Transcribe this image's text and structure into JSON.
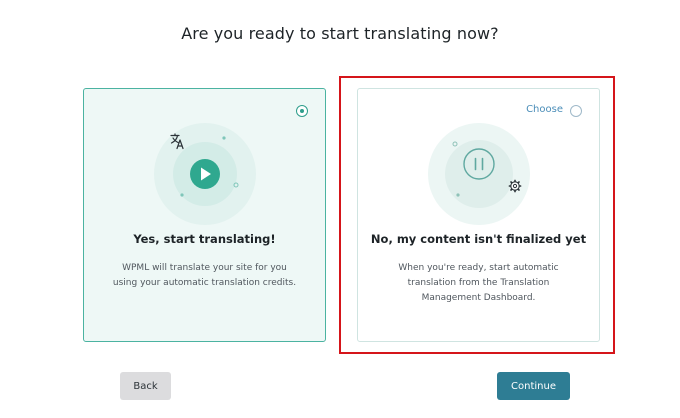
{
  "page": {
    "title": "Are you ready to start translating now?"
  },
  "cards": {
    "yes": {
      "title": "Yes, start translating!",
      "description_line1": "WPML will translate your site for you",
      "description_line2": "using your automatic translation credits.",
      "selected": true,
      "icon": "play-icon",
      "badge_icon": "translate-icon"
    },
    "no": {
      "choose_label": "Choose",
      "title": "No, my content isn't finalized yet",
      "description_line1": "When you're ready, start automatic",
      "description_line2": "translation from the Translation",
      "description_line3": "Management Dashboard.",
      "selected": false,
      "icon": "pause-icon",
      "badge_icon": "gear-icon"
    }
  },
  "buttons": {
    "back_label": "Back",
    "continue_label": "Continue"
  },
  "colors": {
    "accent": "#2e9e8c",
    "continue_bg": "#2e7d94",
    "highlight": "#d5151a"
  }
}
